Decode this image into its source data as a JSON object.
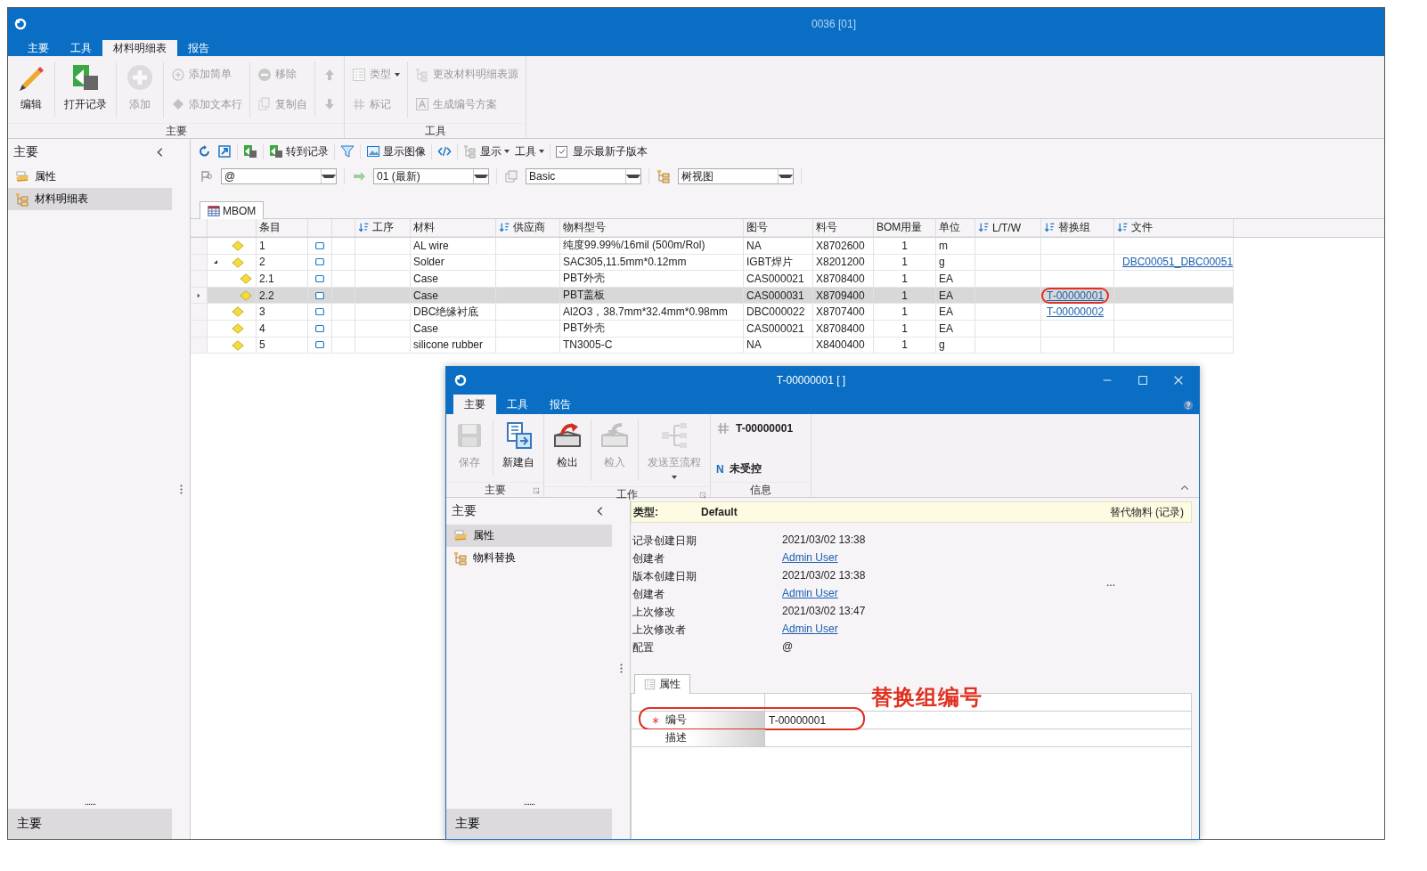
{
  "window": {
    "title": "0036 [01]"
  },
  "tabs": [
    {
      "label": "主要",
      "selected": false
    },
    {
      "label": "工具",
      "selected": false
    },
    {
      "label": "材料明细表",
      "selected": true
    },
    {
      "label": "报告",
      "selected": false
    }
  ],
  "ribbon": {
    "groups": [
      {
        "label": "主要",
        "launcher": false,
        "columns": [
          {
            "kind": "large",
            "items": [
              {
                "label": "编辑",
                "disabled": false,
                "dropdown": false
              }
            ]
          },
          {
            "kind": "large",
            "items": [
              {
                "label": "打开记录",
                "disabled": false,
                "dropdown": false
              }
            ]
          },
          {
            "kind": "large",
            "items": [
              {
                "label": "添加",
                "disabled": true,
                "dropdown": false
              }
            ]
          },
          {
            "kind": "small",
            "items": [
              {
                "label": "添加简单",
                "disabled": true,
                "dropdown": false
              },
              {
                "label": "添加文本行",
                "disabled": true,
                "dropdown": false
              }
            ]
          },
          {
            "kind": "small",
            "items": [
              {
                "label": "移除",
                "disabled": true,
                "dropdown": false
              },
              {
                "label": "复制自",
                "disabled": true,
                "dropdown": false
              }
            ]
          },
          {
            "kind": "small",
            "items": [
              {
                "disabled": true,
                "dropdown": false
              },
              {
                "disabled": true,
                "dropdown": false
              }
            ]
          }
        ]
      },
      {
        "label": "工具",
        "launcher": false,
        "columns": [
          {
            "kind": "small",
            "items": [
              {
                "label": "类型",
                "disabled": true,
                "dropdown": true
              },
              {
                "label": "标记",
                "disabled": true,
                "dropdown": false
              }
            ]
          },
          {
            "kind": "small",
            "items": [
              {
                "label": "更改材料明细表源",
                "disabled": true,
                "dropdown": false
              },
              {
                "label": "生成编号方案",
                "disabled": true,
                "dropdown": false
              }
            ]
          }
        ]
      }
    ]
  },
  "sidebar": {
    "title": "主要",
    "items": [
      {
        "label": "属性",
        "selected": false
      },
      {
        "label": "材料明细表",
        "selected": true
      }
    ],
    "more": "......",
    "footer": "主要"
  },
  "toolbar": {
    "groups": [
      [
        {
          "kind": "icon"
        },
        {
          "kind": "icon"
        }
      ],
      [
        {
          "kind": "icon"
        }
      ],
      [
        {
          "kind": "button",
          "label": "转到记录"
        }
      ],
      [
        {
          "kind": "icon"
        }
      ],
      [
        {
          "kind": "button",
          "label": "显示图像"
        }
      ],
      [
        {
          "kind": "icon"
        }
      ],
      [
        {
          "kind": "menu",
          "label": "显示"
        },
        {
          "kind": "menu",
          "label": "工具"
        }
      ],
      [
        {
          "kind": "checkbox",
          "label": "显示最新子版本",
          "checked": true
        }
      ]
    ]
  },
  "filters": [
    {
      "value": "@"
    },
    {
      "value": "01 (最新)"
    },
    {
      "value": "Basic"
    },
    {
      "value": "树视图"
    }
  ],
  "view_tab": {
    "label": "MBOM"
  },
  "table": {
    "columns": [
      {
        "label": "条目",
        "sort": false
      },
      {
        "label": "工序",
        "sort": true
      },
      {
        "label": "材料",
        "sort": false
      },
      {
        "label": "供应商",
        "sort": true
      },
      {
        "label": "物料型号",
        "sort": false
      },
      {
        "label": "图号",
        "sort": false
      },
      {
        "label": "料号",
        "sort": false
      },
      {
        "label": "BOM用量",
        "sort": false
      },
      {
        "label": "单位",
        "sort": false
      },
      {
        "label": "L/T/W",
        "sort": true
      },
      {
        "label": "替换组",
        "sort": true
      },
      {
        "label": "文件",
        "sort": true
      }
    ],
    "rows": [
      {
        "item": "1",
        "material": "AL wire",
        "model": "纯度99.99%/16mil (500m/Rol)",
        "drawing": "NA",
        "part_no": "X8702600",
        "qty": "1",
        "unit": "m",
        "selected": false
      },
      {
        "item": "2",
        "material": "Solder",
        "model": "SAC305,11.5mm*0.12mm",
        "drawing": "IGBT焊片",
        "part_no": "X8201200",
        "qty": "1",
        "unit": "g",
        "file": "DBC00051_DBC00051",
        "selected": false,
        "expanded": true,
        "children": [
          {
            "item": "2.1",
            "material": "Case",
            "model": "PBT外壳",
            "drawing": "CAS000021",
            "part_no": "X8708400",
            "qty": "1",
            "unit": "EA",
            "selected": false
          },
          {
            "item": "2.2",
            "material": "Case",
            "model": "PBT盖板",
            "drawing": "CAS000031",
            "part_no": "X8709400",
            "qty": "1",
            "unit": "EA",
            "substitute": {
              "text": "T-00000001",
              "circled": true
            },
            "selected": true
          }
        ]
      },
      {
        "item": "3",
        "material": "DBC绝缘衬底",
        "model": "Al2O3，38.7mm*32.4mm*0.98mm",
        "drawing": "DBC000022",
        "part_no": "X8707400",
        "qty": "1",
        "unit": "EA",
        "substitute": {
          "text": "T-00000002",
          "circled": false
        },
        "selected": false
      },
      {
        "item": "4",
        "material": "Case",
        "model": "PBT外壳",
        "drawing": "CAS000021",
        "part_no": "X8708400",
        "qty": "1",
        "unit": "EA",
        "selected": false
      },
      {
        "item": "5",
        "material": "silicone rubber",
        "model": "TN3005-C",
        "drawing": "NA",
        "part_no": "X8400400",
        "qty": "1",
        "unit": "g",
        "selected": false
      }
    ]
  },
  "dialog": {
    "title": "T-00000001 [ ]",
    "tabs": [
      {
        "label": "主要",
        "selected": true
      },
      {
        "label": "工具",
        "selected": false
      },
      {
        "label": "报告",
        "selected": false
      }
    ],
    "ribbon": {
      "groups": [
        {
          "label": "主要",
          "launcher": true,
          "columns": [
            {
              "kind": "large",
              "items": [
                {
                  "label": "保存",
                  "disabled": true,
                  "dropdown": false
                }
              ]
            },
            {
              "kind": "large",
              "items": [
                {
                  "label": "新建自",
                  "disabled": false,
                  "dropdown": false
                }
              ]
            }
          ]
        },
        {
          "label": "工作",
          "launcher": true,
          "columns": [
            {
              "kind": "large",
              "items": [
                {
                  "label": "检出",
                  "disabled": false,
                  "dropdown": false
                }
              ]
            },
            {
              "kind": "large",
              "items": [
                {
                  "label": "检入",
                  "disabled": true,
                  "dropdown": false
                }
              ]
            },
            {
              "kind": "large",
              "items": [
                {
                  "label": "发送至流程",
                  "disabled": true,
                  "dropdown": true
                }
              ]
            }
          ]
        },
        {
          "label": "信息",
          "launcher": false,
          "columns": [
            {
              "kind": "info",
              "items": [
                {
                  "label": "T-00000001"
                },
                {
                  "badge": "N",
                  "label": "未受控"
                }
              ]
            }
          ]
        }
      ]
    },
    "sidebar": {
      "title": "主要",
      "items": [
        {
          "label": "属性",
          "selected": true
        },
        {
          "label": "物料替换",
          "selected": false
        }
      ],
      "more": "......",
      "footer": "主要"
    },
    "info_bar": {
      "label": "类型:",
      "value": "Default",
      "record_type": "替代物料 (记录)"
    },
    "properties": [
      {
        "label": "记录创建日期",
        "value": "2021/03/02 13:38",
        "kind": "text"
      },
      {
        "label": "创建者",
        "value": "Admin User",
        "kind": "link"
      },
      {
        "label": "版本创建日期",
        "value": "2021/03/02 13:38",
        "kind": "text"
      },
      {
        "label": "创建者",
        "value": "Admin User",
        "kind": "link"
      },
      {
        "label": "上次修改",
        "value": "2021/03/02 13:47",
        "kind": "text"
      },
      {
        "label": "上次修改者",
        "value": "Admin User",
        "kind": "link"
      },
      {
        "label": "配置",
        "value": "@",
        "kind": "text"
      }
    ],
    "more": "...",
    "prop_tab": {
      "label": "属性"
    },
    "grid_rows": [
      {
        "label": "编号",
        "required": true,
        "value": "T-00000001",
        "circled": true
      },
      {
        "label": "描述",
        "required": false,
        "circled": false
      }
    ]
  },
  "callout": {
    "text": "替换组编号"
  }
}
